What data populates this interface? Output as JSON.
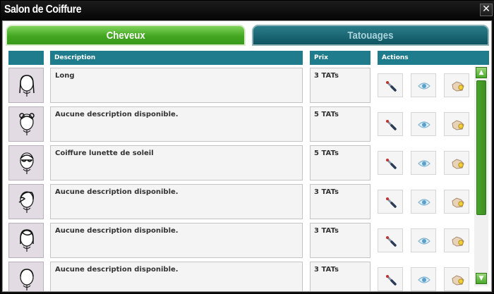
{
  "window": {
    "title": "Salon de Coiffure",
    "close_symbol": "✕"
  },
  "tabs": [
    {
      "label": "Cheveux",
      "active": true
    },
    {
      "label": "Tatouages",
      "active": false
    }
  ],
  "table": {
    "headers": {
      "image": "",
      "description": "Description",
      "price": "Prix",
      "actions": "Actions"
    },
    "rows": [
      {
        "hairstyle_icon": "long-hair-icon",
        "description": "Long",
        "price": "3 TATs"
      },
      {
        "hairstyle_icon": "buns-hair-icon",
        "description": "Aucune description disponible.",
        "price": "5 TATs"
      },
      {
        "hairstyle_icon": "sunglasses-hair-icon",
        "description": "Coiffure lunette de soleil",
        "price": "5 TATs"
      },
      {
        "hairstyle_icon": "swept-hair-icon",
        "description": "Aucune description disponible.",
        "price": "3 TATs"
      },
      {
        "hairstyle_icon": "bob-hair-icon",
        "description": "Aucune description disponible.",
        "price": "3 TATs"
      },
      {
        "hairstyle_icon": "short-hair-icon",
        "description": "Aucune description disponible.",
        "price": "3 TATs"
      }
    ],
    "action_icons": [
      "pipette-icon",
      "eye-icon",
      "buy-hand-icon"
    ]
  },
  "scrollbar": {
    "up_symbol": "▲",
    "down_symbol": "▼",
    "position": 0
  },
  "colors": {
    "active_tab": "#42a620",
    "inactive_tab": "#0f5361",
    "header": "#1f7c8c",
    "scroll_accent": "#4aa42a"
  }
}
